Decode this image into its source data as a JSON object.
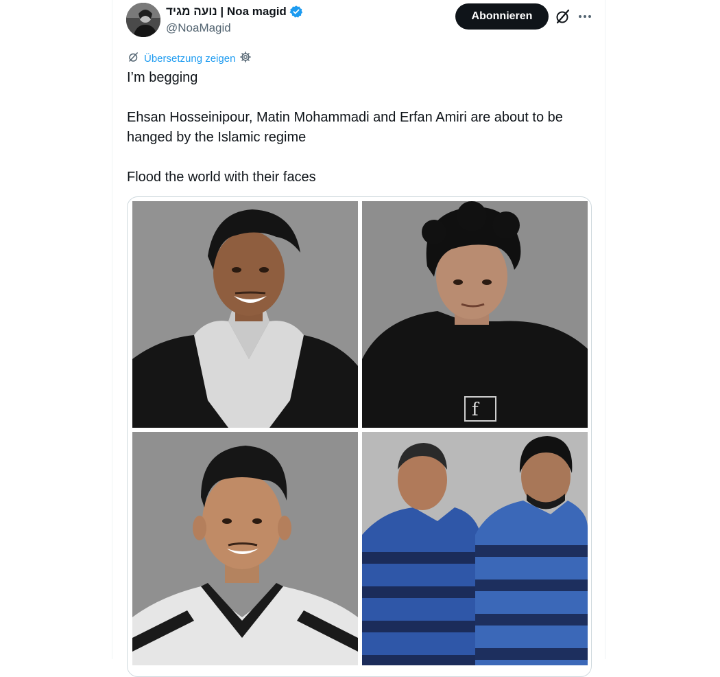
{
  "author": {
    "display_name": "נועה מגיד | Noa magid",
    "handle": "@NoaMagid",
    "verified": true,
    "avatar_icon": "profile-photo"
  },
  "header": {
    "follow_label": "Abonnieren",
    "grok_icon": "grok-icon",
    "more_icon": "more-dots-icon"
  },
  "translate": {
    "label": "Übersetzung zeigen",
    "link_color": "#1d9bf0"
  },
  "tweet": {
    "paragraphs": [
      "I’m begging",
      "Ehsan Hosseinipour, Matin Mohammadi and Erfan Amiri are about to be hanged by the Islamic regime",
      "Flood the world with their faces"
    ]
  },
  "media": {
    "photos": [
      {
        "alt": "portrait-smiling-man-hoodie"
      },
      {
        "alt": "portrait-young-man-curly-hair"
      },
      {
        "alt": "portrait-smiling-man-sports-jersey"
      },
      {
        "alt": "two-men-prison-uniforms"
      }
    ]
  },
  "colors": {
    "text": "#0f1419",
    "secondary": "#536471",
    "accent": "#1d9bf0",
    "button": "#0f1419"
  }
}
